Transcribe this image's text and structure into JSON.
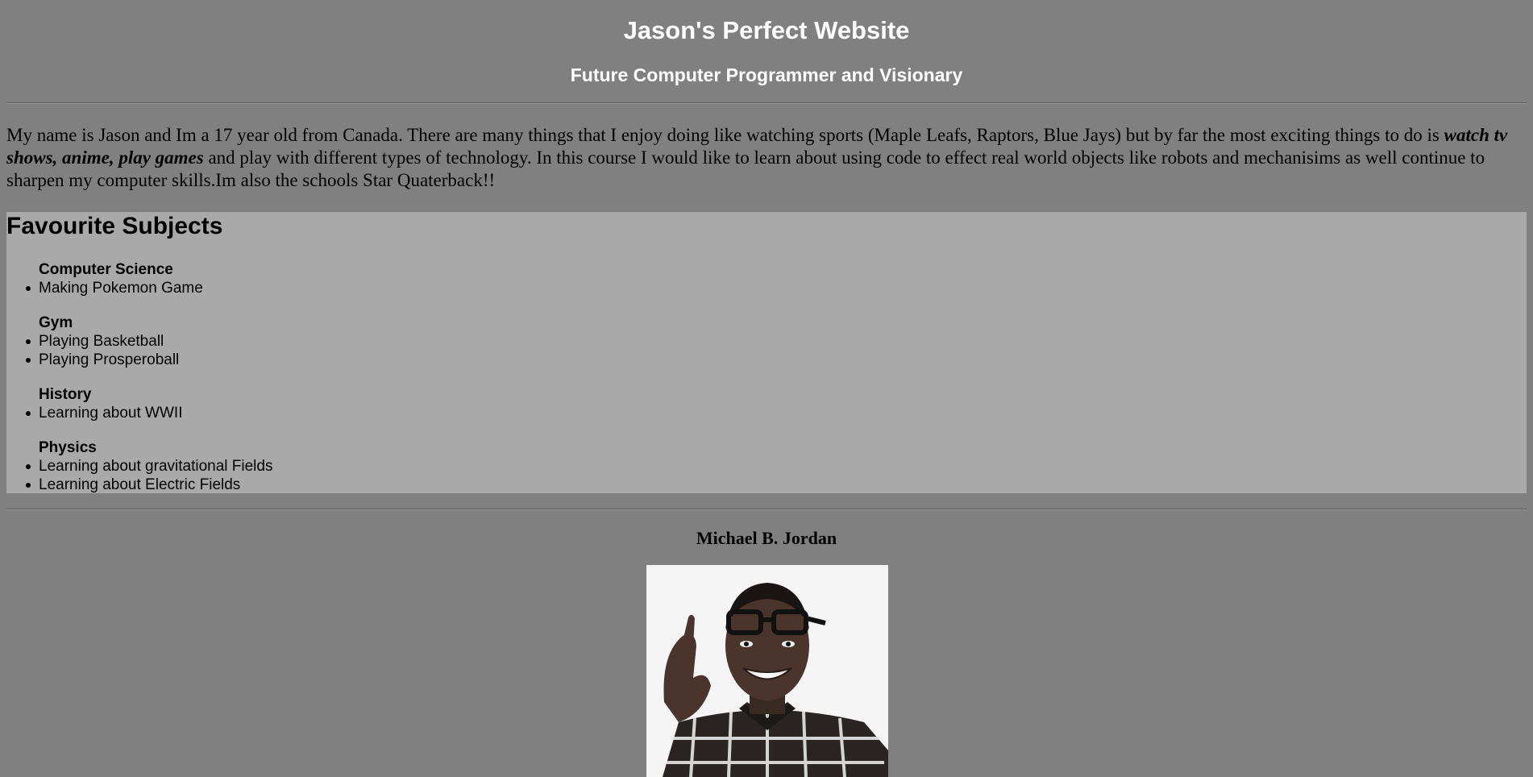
{
  "header": {
    "title": "Jason's Perfect Website",
    "subtitle": "Future Computer Programmer and Visionary"
  },
  "intro": {
    "part1": "My name is Jason and Im a 17 year old from Canada. There are many things that I enjoy doing like watching sports (Maple Leafs, Raptors, Blue Jays) but by far the most exciting things to do is ",
    "emphasis": "watch tv shows, anime, play games",
    "part2": " and play with different types of technology. In this course I would like to learn about using code to effect real world objects like robots and mechanisims as well continue to sharpen my computer skills.Im also the schools Star Quaterback!!"
  },
  "subjects": {
    "heading": "Favourite Subjects",
    "items": [
      {
        "name": "Computer Science",
        "entries": [
          "Making Pokemon Game"
        ]
      },
      {
        "name": "Gym",
        "entries": [
          "Playing Basketball",
          "Playing Prosperoball"
        ]
      },
      {
        "name": "History",
        "entries": [
          "Learning about WWII"
        ]
      },
      {
        "name": "Physics",
        "entries": [
          "Learning about gravitational Fields",
          "Learning about Electric Fields"
        ]
      }
    ]
  },
  "feature": {
    "name": "Michael B. Jordan",
    "photo_icon": "portrait-photo"
  },
  "colors": {
    "background": "#808080",
    "panel": "#a9a9a9",
    "heading_text": "#ffffff"
  }
}
